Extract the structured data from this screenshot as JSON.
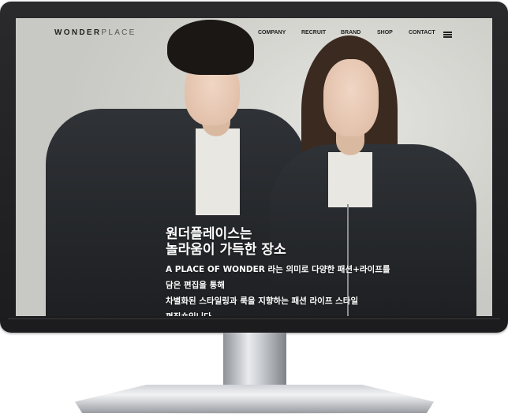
{
  "header": {
    "logo_primary": "WONDER",
    "logo_secondary": "PLACE",
    "nav": [
      {
        "label": "COMPANY"
      },
      {
        "label": "RECRUIT"
      },
      {
        "label": "BRAND"
      },
      {
        "label": "SHOP"
      },
      {
        "label": "CONTACT"
      }
    ],
    "menu_icon": "hamburger-icon"
  },
  "hero": {
    "title_line1": "원더플레이스는",
    "title_line2": "놀라움이 가득한 장소",
    "desc_line1": "A PLACE OF WONDER 라는 의미로 다양한 패션+라이프를",
    "desc_line2": "담은 편집을 통해",
    "desc_line3": "차별화된 스타일링과 룩을 지향하는 패션 라이프 스타일",
    "desc_line4": "편집숍입니다."
  },
  "colors": {
    "monitor_bezel": "#1c1c1e",
    "hero_text": "#ffffff",
    "nav_text": "#222222"
  }
}
